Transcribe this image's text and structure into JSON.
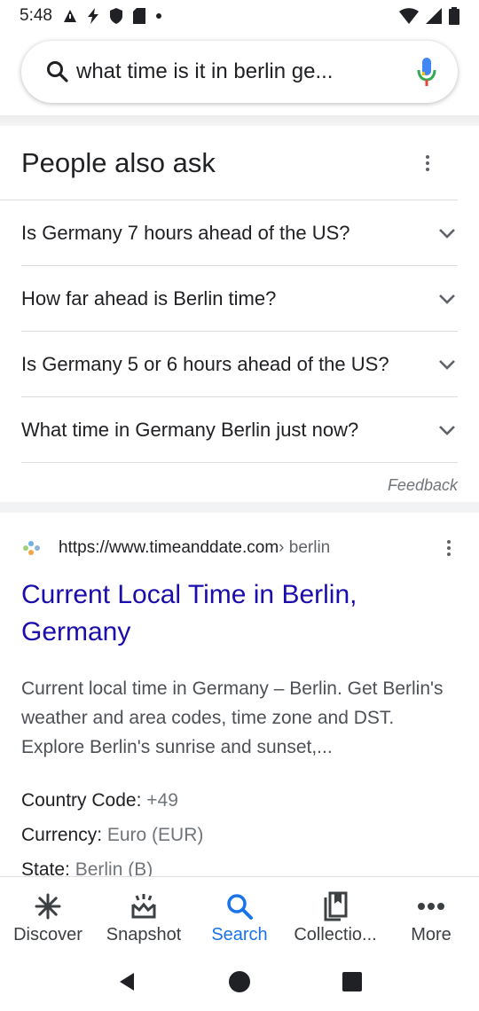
{
  "status_bar": {
    "time": "5:48"
  },
  "search": {
    "query": "what time is it in berlin ge..."
  },
  "paa": {
    "title": "People also ask",
    "questions": [
      "Is Germany 7 hours ahead of the US?",
      "How far ahead is Berlin time?",
      "Is Germany 5 or 6 hours ahead of the US?",
      "What time in Germany Berlin just now?"
    ],
    "feedback": "Feedback"
  },
  "result": {
    "url": "https://www.timeanddate.com",
    "url_path": " › berlin",
    "title": "Current Local Time in Berlin, Germany",
    "snippet": "Current local time in Germany – Berlin. Get Berlin's weather and area codes, time zone and DST. Explore Berlin's sunrise and sunset,...",
    "facts": [
      {
        "label": "Country Code: ",
        "value": "+49"
      },
      {
        "label": "Currency: ",
        "value": "Euro (EUR)"
      },
      {
        "label": "State: ",
        "value": "Berlin (B)"
      }
    ]
  },
  "bottom_nav": {
    "items": [
      {
        "label": "Discover",
        "icon": "asterisk-icon"
      },
      {
        "label": "Snapshot",
        "icon": "snapshot-icon"
      },
      {
        "label": "Search",
        "icon": "search-icon"
      },
      {
        "label": "Collectio...",
        "icon": "collections-icon"
      },
      {
        "label": "More",
        "icon": "more-icon"
      }
    ],
    "active": "Search"
  },
  "colors": {
    "link": "#1a0dab",
    "accent": "#1a73e8",
    "text": "#202124",
    "secondary": "#70757a"
  }
}
